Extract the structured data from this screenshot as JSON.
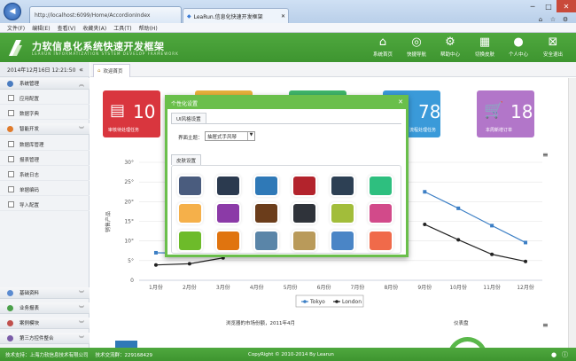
{
  "browser": {
    "tab1_url": "http://localhost:6099/Home/AccordionIndex",
    "tab2_title": "LeaRun.信息化快速开发框架",
    "menu": [
      "文件(F)",
      "编辑(E)",
      "查看(V)",
      "收藏夹(A)",
      "工具(T)",
      "帮助(H)"
    ]
  },
  "header": {
    "title": "力软信息化系统快速开发框架",
    "subtitle": "LEARUN INFORMATIZATION SYSTEM DEVELOP FRAMEWORK",
    "nav": [
      "系统首页",
      "快捷导航",
      "帮助中心",
      "切换皮肤",
      "个人中心",
      "安全退出"
    ]
  },
  "sidebar": {
    "datetime": "2014年12月16日 12:21:50",
    "top_section": "系统管理",
    "items": [
      "应用配置",
      "数据字典"
    ],
    "section2": "智能开发",
    "items2": [
      "数据库管理",
      "报表管理",
      "系统日志",
      "单据编码",
      "导入配置"
    ],
    "bottom_sections": [
      "基础资料",
      "业务报表",
      "案例模块",
      "第三方控件整合"
    ]
  },
  "main": {
    "home_tab": "欢迎首页",
    "cards": [
      {
        "num": "10",
        "label": "审核待处理任务",
        "color": "#d9363e"
      },
      {
        "num": "",
        "label": "",
        "color": "#e8b13b"
      },
      {
        "num": "",
        "label": "",
        "color": "#3fb56a"
      },
      {
        "num": "78",
        "label": "流程处理任务",
        "color": "#3a9ad9"
      },
      {
        "num": "18",
        "label": "本周新增订单",
        "color": "#b276c9"
      }
    ]
  },
  "chart_data": {
    "type": "line",
    "categories": [
      "1月份",
      "2月份",
      "3月份",
      "4月份",
      "5月份",
      "6月份",
      "7月份",
      "8月份",
      "9月份",
      "10月份",
      "11月份",
      "12月份"
    ],
    "ylabel": "销售产品",
    "ylim": [
      0,
      30
    ],
    "yticks": [
      "0",
      "5°",
      "10°",
      "15°",
      "20°",
      "25°",
      "30°"
    ],
    "series": [
      {
        "name": "Tokyo",
        "values": [
          7.0,
          6.9,
          null,
          null,
          null,
          null,
          null,
          null,
          22.5,
          18.3,
          13.9,
          9.6
        ],
        "color": "#3c7fc5"
      },
      {
        "name": "London",
        "values": [
          3.9,
          4.2,
          5.7,
          null,
          null,
          null,
          null,
          null,
          14.2,
          10.3,
          6.6,
          4.8
        ],
        "color": "#222"
      }
    ]
  },
  "bottom": {
    "left_title": "浏览器的市场份额，2011年4月",
    "right_title": "仪表盘"
  },
  "modal": {
    "title": "个性化设置",
    "ui_tab": "UI风格设置",
    "theme_label": "界面主题：",
    "theme_value": "抽屉式手风琴",
    "skin_tab": "皮肤设置",
    "skins": [
      "#4a5c7e",
      "#2b3a4f",
      "#2f79b7",
      "#b3232c",
      "#2d4054",
      "#2ebf7f",
      "#f5b04a",
      "#8b3aa7",
      "#6b3d1b",
      "#2f333a",
      "#a2bd3a",
      "#d24a8a",
      "#6dbb2a",
      "#e0740f",
      "#5a85a8",
      "#b99a5a",
      "#4a85c6",
      "#f06a4a"
    ]
  },
  "footer": {
    "left": "技术支持：上海力软信息技术有限公司",
    "qq": "技术交流群：229168429",
    "copy": "CopyRight © 2010-2014 By Learun"
  }
}
